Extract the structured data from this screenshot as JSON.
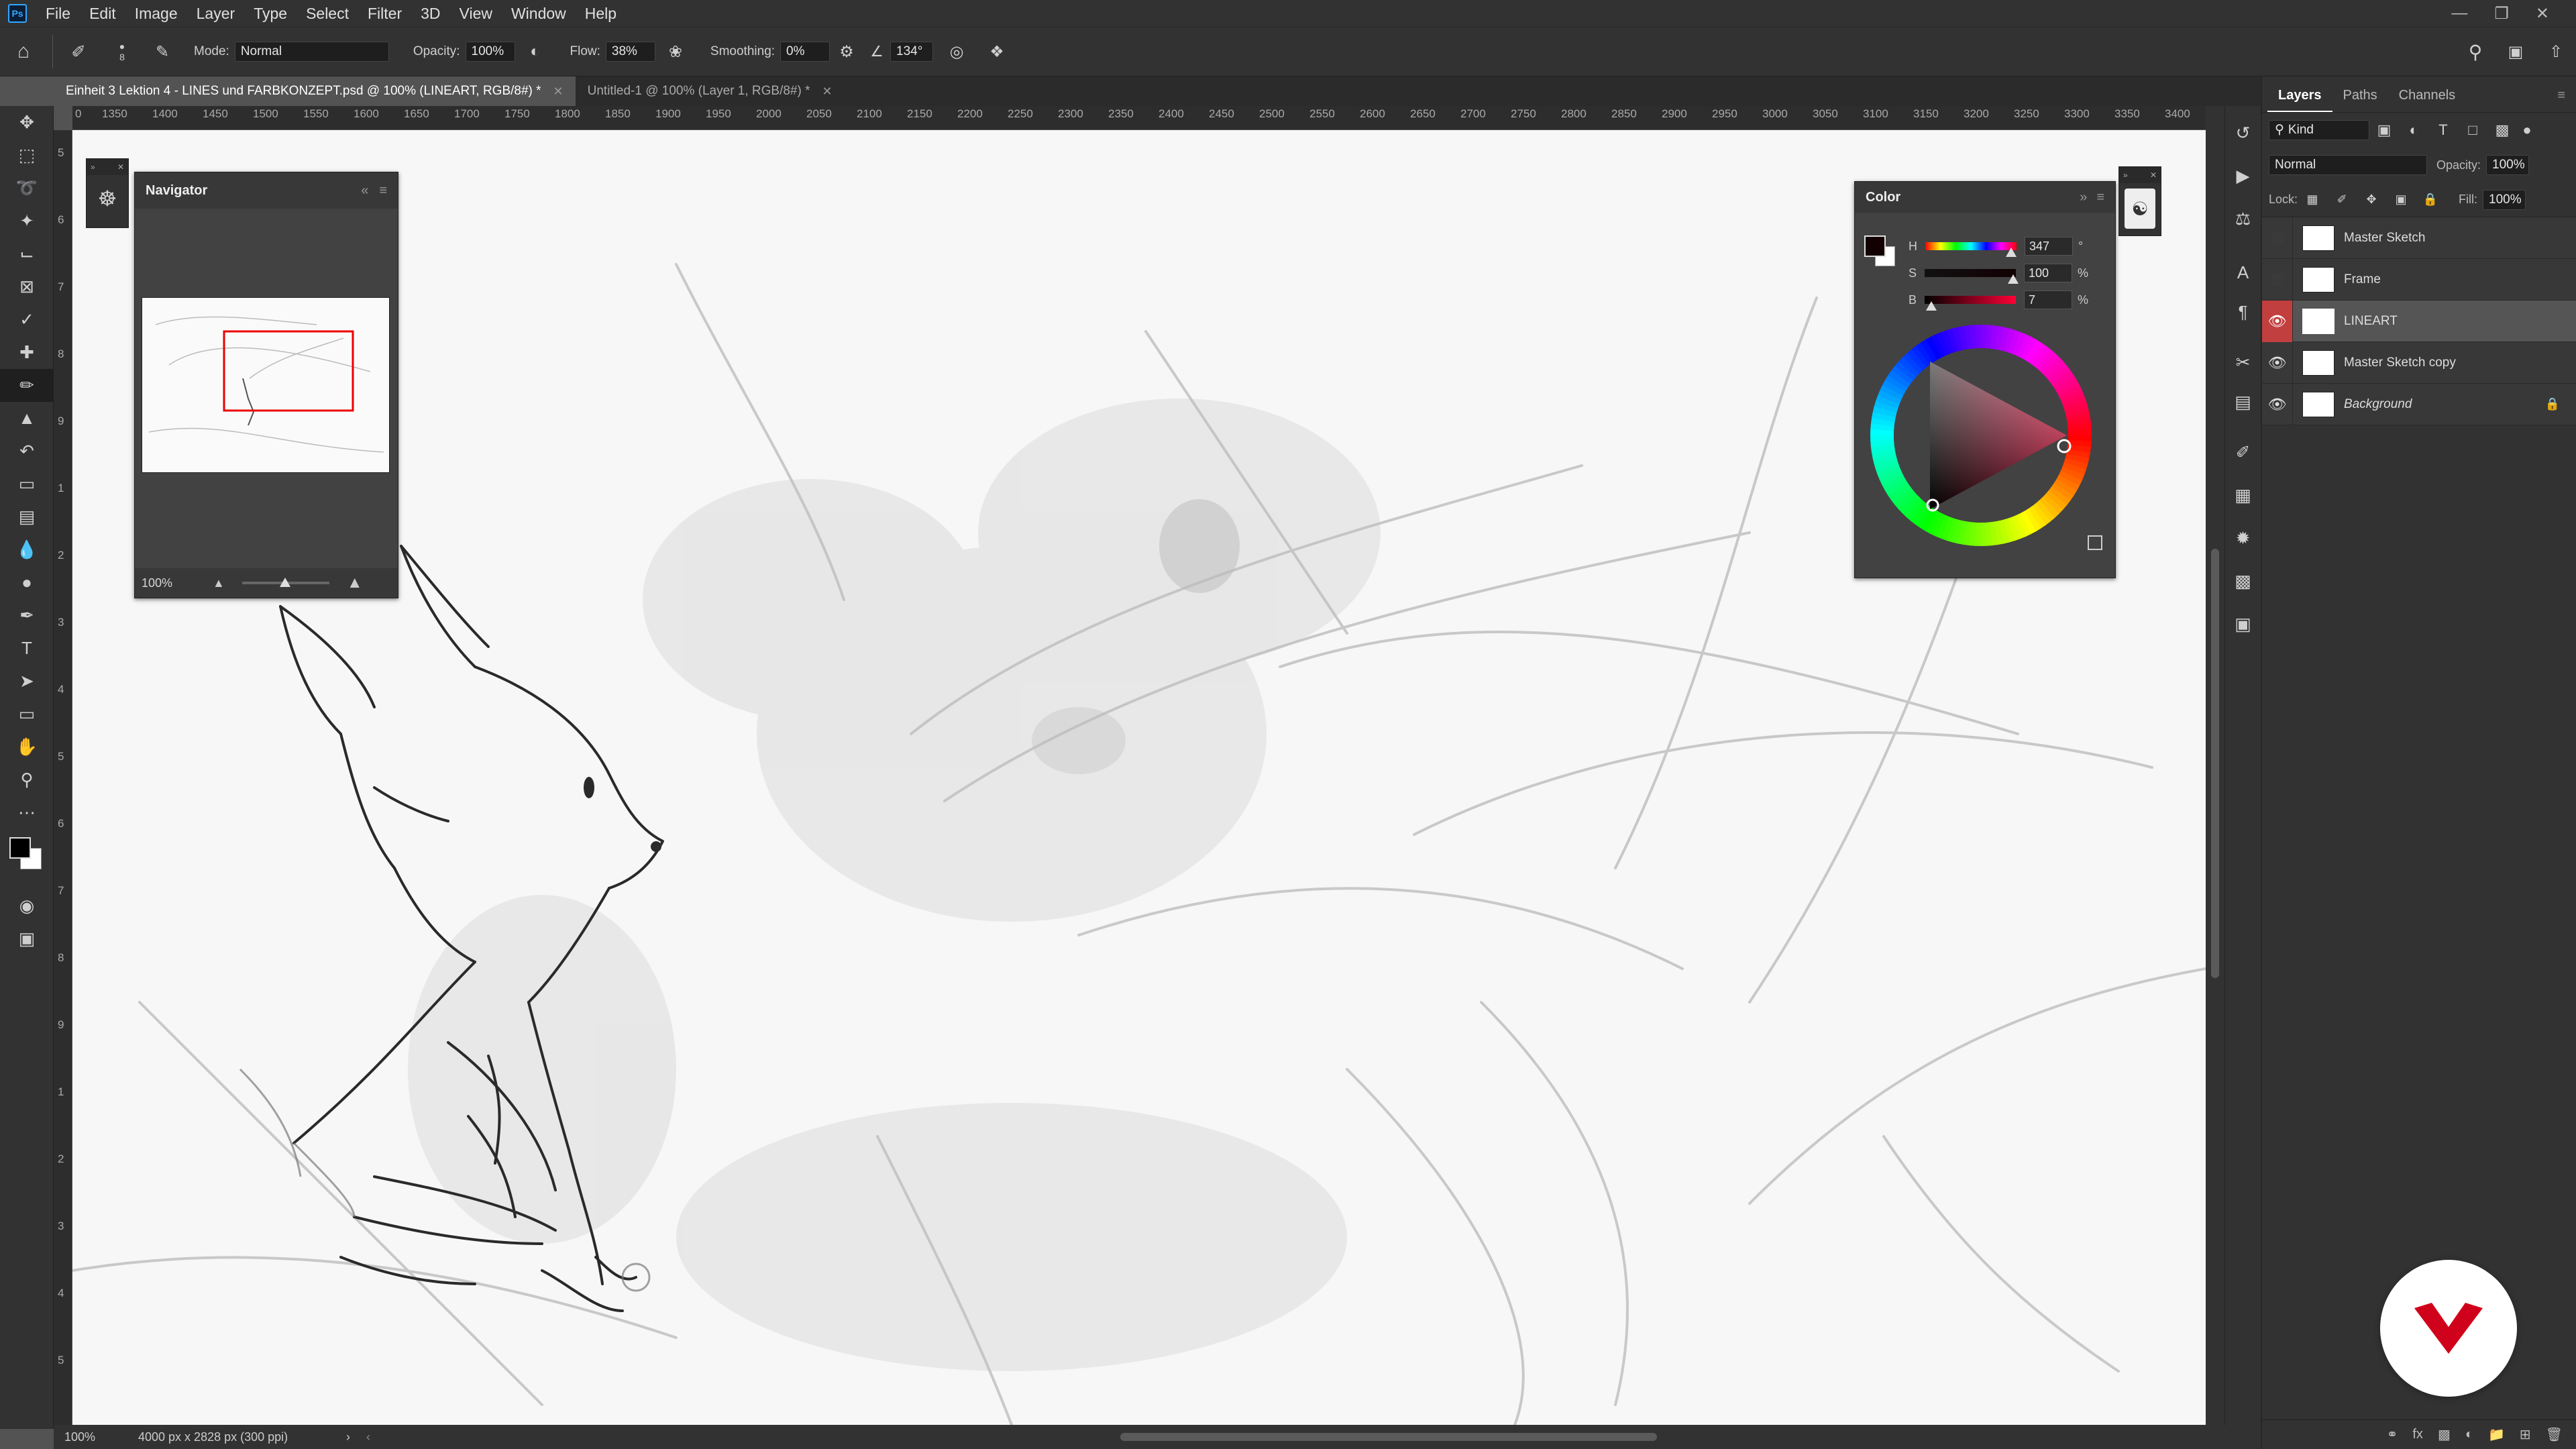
{
  "menubar": {
    "logo": "Ps",
    "items": [
      "File",
      "Edit",
      "Image",
      "Layer",
      "Type",
      "Select",
      "Filter",
      "3D",
      "View",
      "Window",
      "Help"
    ]
  },
  "options": {
    "brush_size": "8",
    "mode_label": "Mode:",
    "mode_value": "Normal",
    "opacity_label": "Opacity:",
    "opacity_value": "100%",
    "flow_label": "Flow:",
    "flow_value": "38%",
    "smoothing_label": "Smoothing:",
    "smoothing_value": "0%",
    "angle_value": "134°"
  },
  "tabs": [
    {
      "title": "Einheit 3 Lektion 4 - LINES und FARBKONZEPT.psd @ 100% (LINEART, RGB/8#) *"
    },
    {
      "title": "Untitled-1 @ 100% (Layer 1, RGB/8#) *"
    }
  ],
  "ruler": {
    "ticks": [
      "0",
      "1350",
      "1400",
      "1450",
      "1500",
      "1550",
      "1600",
      "1650",
      "1700",
      "1750",
      "1800",
      "1850",
      "1900",
      "1950",
      "2000",
      "2050",
      "2100",
      "2150",
      "2200",
      "2250",
      "2300",
      "2350",
      "2400",
      "2450",
      "2500",
      "2550",
      "2600",
      "2650",
      "2700",
      "2750",
      "2800",
      "2850",
      "2900",
      "2950",
      "3000",
      "3050",
      "3100",
      "3150",
      "3200",
      "3250",
      "3300",
      "3350",
      "3400"
    ],
    "left_ticks": [
      "5",
      "6",
      "7",
      "8",
      "9",
      "1",
      "2",
      "3",
      "4",
      "5",
      "6",
      "7",
      "8",
      "9",
      "1",
      "2",
      "3",
      "4",
      "5"
    ]
  },
  "navigator": {
    "title": "Navigator",
    "zoom": "100%"
  },
  "color_panel": {
    "title": "Color",
    "h_label": "H",
    "h_value": "347",
    "h_unit": "°",
    "s_label": "S",
    "s_value": "100",
    "s_unit": "%",
    "b_label": "B",
    "b_value": "7",
    "b_unit": "%",
    "foreground": "#120003"
  },
  "layers_panel": {
    "tabs": [
      "Layers",
      "Paths",
      "Channels"
    ],
    "kind_label": "Kind",
    "blend_mode": "Normal",
    "opacity_label": "Opacity:",
    "opacity_value": "100%",
    "lock_label": "Lock:",
    "fill_label": "Fill:",
    "fill_value": "100%",
    "layers": [
      {
        "name": "Master Sketch",
        "visible": false
      },
      {
        "name": "Frame",
        "visible": false
      },
      {
        "name": "LINEART",
        "visible": true
      },
      {
        "name": "Master Sketch copy",
        "visible": true
      },
      {
        "name": "Background",
        "visible": true
      }
    ]
  },
  "status": {
    "zoom": "100%",
    "doc_info": "4000 px x 2828 px (300 ppi)"
  }
}
